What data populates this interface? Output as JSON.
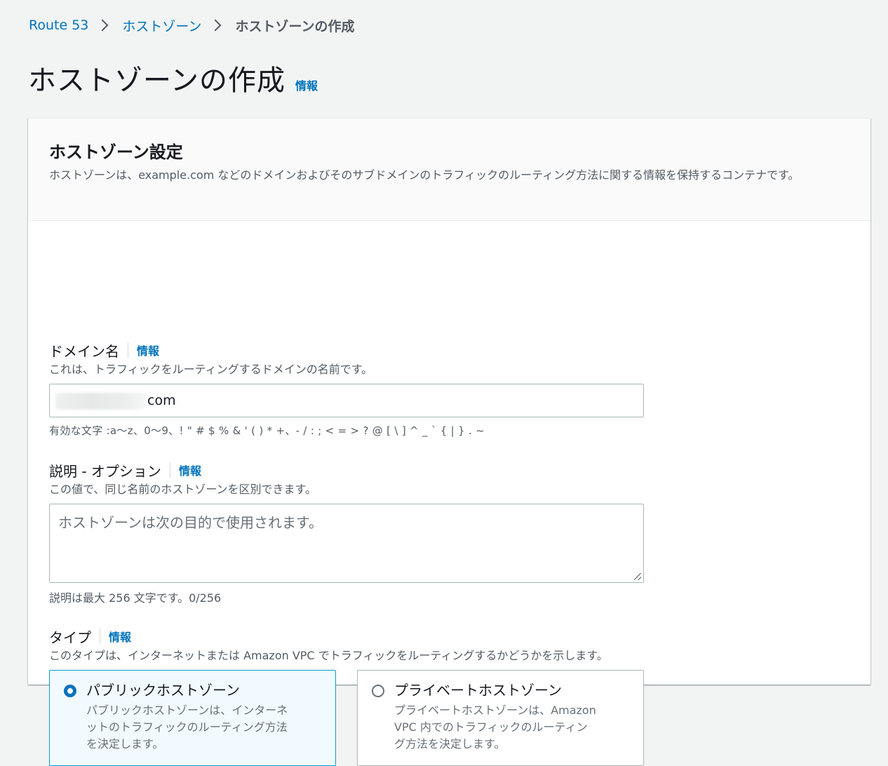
{
  "breadcrumb": {
    "items": [
      "Route 53",
      "ホストゾーン"
    ],
    "current": "ホストゾーンの作成"
  },
  "page": {
    "title": "ホストゾーンの作成",
    "info": "情報"
  },
  "panel": {
    "title": "ホストゾーン設定",
    "description": "ホストゾーンは、example.com などのドメインおよびそのサブドメインのトラフィックのルーティング方法に関する情報を保持するコンテナです。"
  },
  "domain": {
    "label": "ドメイン名",
    "info": "情報",
    "hint": "これは、トラフィックをルーティングするドメインの名前です。",
    "value_visible": "com",
    "constraint": "有効な文字 :a〜z、0〜9、! \" # $ % & ' ( ) * +、- / : ; < = > ? @ [ \\ ] ^ _ ` { | } . ~"
  },
  "description": {
    "label": "説明 - オプション",
    "info": "情報",
    "hint": "この値で、同じ名前のホストゾーンを区別できます。",
    "placeholder": "ホストゾーンは次の目的で使用されます。",
    "counter": "説明は最大 256 文字です。0/256"
  },
  "type": {
    "label": "タイプ",
    "info": "情報",
    "hint": "このタイプは、インターネットまたは Amazon VPC でトラフィックをルーティングするかどうかを示します。",
    "options": [
      {
        "title": "パブリックホストゾーン",
        "desc_lines": [
          "パブリックホストゾーンは、インターネ",
          "ットのトラフィックのルーティング方法",
          "を決定します。"
        ],
        "selected": true
      },
      {
        "title": "プライベートホストゾーン",
        "desc_lines": [
          "プライベートホストゾーンは、Amazon",
          "VPC 内でのトラフィックのルーティン",
          "グ方法を決定します。"
        ],
        "selected": false
      }
    ]
  },
  "colors": {
    "link": "#0073bb",
    "selected_border": "#00a1c9",
    "selected_bg": "#f1faff"
  }
}
